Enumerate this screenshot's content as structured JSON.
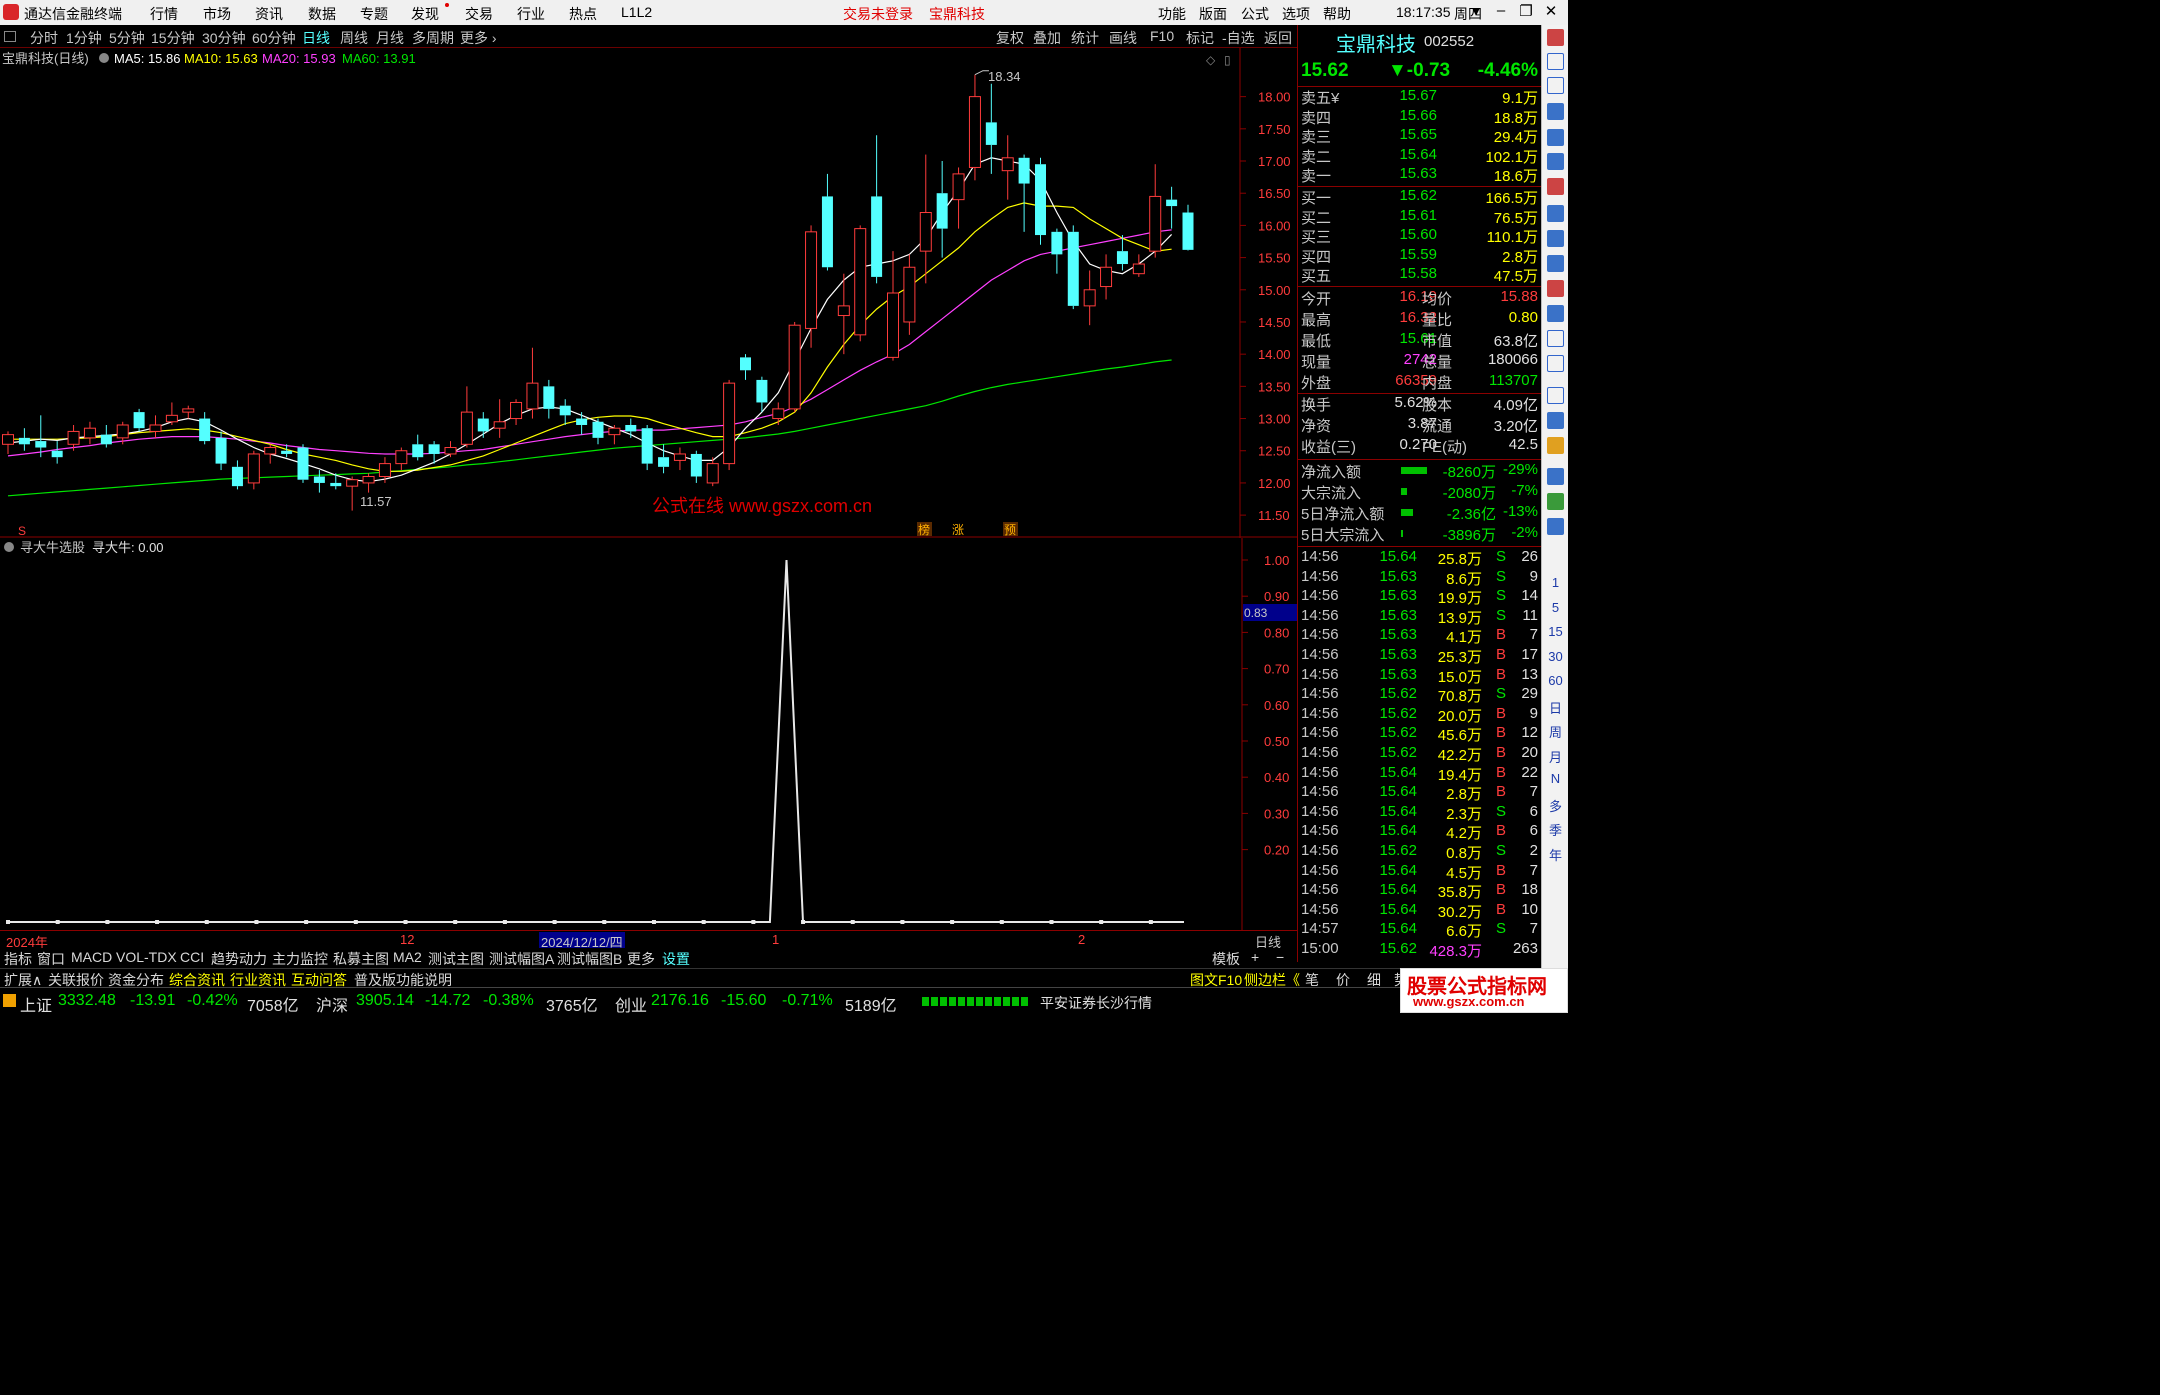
{
  "menubar": {
    "app_title": "通达信金融终端",
    "items": [
      "行情",
      "市场",
      "资讯",
      "数据",
      "专题",
      "发现",
      "交易",
      "行业",
      "热点",
      "L1L2"
    ],
    "login_status": "交易未登录",
    "stock_name": "宝鼎科技",
    "right_items": [
      "功能",
      "版面",
      "公式",
      "选项",
      "帮助"
    ],
    "time": "18:17:35",
    "weekday": "周四"
  },
  "periodbar": {
    "periods": [
      "分时",
      "1分钟",
      "5分钟",
      "15分钟",
      "30分钟",
      "60分钟",
      "日线",
      "周线",
      "月线",
      "多周期",
      "更多"
    ],
    "active": "日线",
    "tools": [
      "复权",
      "叠加",
      "统计",
      "画线",
      "F10",
      "标记",
      "-自选",
      "返回"
    ]
  },
  "chart_header": {
    "title": "宝鼎科技(日线)",
    "ma5": "MA5: 15.86",
    "ma10": "MA10: 15.63",
    "ma20": "MA20: 15.93",
    "ma60": "MA60: 13.91"
  },
  "chart_marks": {
    "high_label": "18.34",
    "low_label": "11.57",
    "watermark": "公式在线  www.gszx.com.cn",
    "flags": [
      "榜",
      "涨",
      "预"
    ],
    "s_flag": "S"
  },
  "indicator_header": {
    "name": "寻大牛选股",
    "value": "寻大牛: 0.00",
    "current_marker": "0.83"
  },
  "colors": {
    "up": "#ff3c3c",
    "down": "#54ffff",
    "ma5": "#ffffff",
    "ma10": "#ffff00",
    "ma20": "#ff40ff",
    "ma60": "#00e600",
    "grid": "#8b0000"
  },
  "chart_data": [
    {
      "type": "candlestick",
      "title": "宝鼎科技(日线)",
      "ylim": [
        11.3,
        18.6
      ],
      "yticks": [
        "18.00",
        "17.50",
        "17.00",
        "16.50",
        "16.00",
        "15.50",
        "15.00",
        "14.50",
        "14.00",
        "13.50",
        "13.00",
        "12.50",
        "12.00",
        "11.50"
      ],
      "candles": [
        [
          12.6,
          12.75,
          12.45,
          12.8
        ],
        [
          12.7,
          12.6,
          12.5,
          12.85
        ],
        [
          12.65,
          12.55,
          12.4,
          13.05
        ],
        [
          12.5,
          12.4,
          12.3,
          12.65
        ],
        [
          12.6,
          12.8,
          12.5,
          12.9
        ],
        [
          12.7,
          12.85,
          12.6,
          12.95
        ],
        [
          12.75,
          12.6,
          12.55,
          12.9
        ],
        [
          12.7,
          12.9,
          12.6,
          12.95
        ],
        [
          13.1,
          12.85,
          12.8,
          13.15
        ],
        [
          12.8,
          12.9,
          12.7,
          13.05
        ],
        [
          12.95,
          13.05,
          12.9,
          13.25
        ],
        [
          13.1,
          13.15,
          13.0,
          13.2
        ],
        [
          13.0,
          12.65,
          12.6,
          13.1
        ],
        [
          12.7,
          12.3,
          12.2,
          12.8
        ],
        [
          12.25,
          11.95,
          11.9,
          12.35
        ],
        [
          12.0,
          12.45,
          11.9,
          12.5
        ],
        [
          12.45,
          12.55,
          12.3,
          12.6
        ],
        [
          12.5,
          12.45,
          12.4,
          12.6
        ],
        [
          12.55,
          12.05,
          12.0,
          12.6
        ],
        [
          12.1,
          12.0,
          11.85,
          12.2
        ],
        [
          12.0,
          11.95,
          11.9,
          12.15
        ],
        [
          11.95,
          12.05,
          11.57,
          12.1
        ],
        [
          12.0,
          12.1,
          11.85,
          12.15
        ],
        [
          12.1,
          12.3,
          12.0,
          12.4
        ],
        [
          12.3,
          12.5,
          12.2,
          12.55
        ],
        [
          12.6,
          12.4,
          12.35,
          12.75
        ],
        [
          12.6,
          12.45,
          12.3,
          12.65
        ],
        [
          12.45,
          12.55,
          12.4,
          12.65
        ],
        [
          12.6,
          13.1,
          12.55,
          13.5
        ],
        [
          13.0,
          12.8,
          12.7,
          13.1
        ],
        [
          12.85,
          12.95,
          12.7,
          13.3
        ],
        [
          13.0,
          13.25,
          12.9,
          13.3
        ],
        [
          13.15,
          13.55,
          13.0,
          14.1
        ],
        [
          13.5,
          13.15,
          13.0,
          13.6
        ],
        [
          13.2,
          13.05,
          12.9,
          13.3
        ],
        [
          13.0,
          12.9,
          12.75,
          13.1
        ],
        [
          12.95,
          12.7,
          12.6,
          13.0
        ],
        [
          12.75,
          12.85,
          12.6,
          12.9
        ],
        [
          12.9,
          12.8,
          12.7,
          13.0
        ],
        [
          12.85,
          12.3,
          12.2,
          12.9
        ],
        [
          12.4,
          12.25,
          12.15,
          12.6
        ],
        [
          12.35,
          12.45,
          12.2,
          12.55
        ],
        [
          12.45,
          12.1,
          12.0,
          12.5
        ],
        [
          12.0,
          12.3,
          11.95,
          12.4
        ],
        [
          12.3,
          13.55,
          12.2,
          13.6
        ],
        [
          13.95,
          13.75,
          13.6,
          14.0
        ],
        [
          13.6,
          13.25,
          13.1,
          13.65
        ],
        [
          13.0,
          13.15,
          12.9,
          13.25
        ],
        [
          13.15,
          14.45,
          13.1,
          14.5
        ],
        [
          14.4,
          15.9,
          14.1,
          16.0
        ],
        [
          16.45,
          15.35,
          15.3,
          16.8
        ],
        [
          14.6,
          14.75,
          14.0,
          15.25
        ],
        [
          14.3,
          15.95,
          14.2,
          16.0
        ],
        [
          16.45,
          15.2,
          15.1,
          17.4
        ],
        [
          13.95,
          14.95,
          13.9,
          15.6
        ],
        [
          14.5,
          15.35,
          14.3,
          15.55
        ],
        [
          15.6,
          16.2,
          15.1,
          17.1
        ],
        [
          16.5,
          15.95,
          15.5,
          17.0
        ],
        [
          16.4,
          16.8,
          15.95,
          16.9
        ],
        [
          16.9,
          18.0,
          16.7,
          18.34
        ],
        [
          17.6,
          17.25,
          16.8,
          18.2
        ],
        [
          16.85,
          17.05,
          16.4,
          17.4
        ],
        [
          17.05,
          16.65,
          15.9,
          17.1
        ],
        [
          16.95,
          15.85,
          15.7,
          17.05
        ],
        [
          15.9,
          15.55,
          15.25,
          15.95
        ],
        [
          15.9,
          14.75,
          14.7,
          16.0
        ],
        [
          14.75,
          15.0,
          14.45,
          15.3
        ],
        [
          15.05,
          15.35,
          14.85,
          15.55
        ],
        [
          15.6,
          15.4,
          15.3,
          15.85
        ],
        [
          15.25,
          15.4,
          15.2,
          15.55
        ],
        [
          15.6,
          16.45,
          15.5,
          16.95
        ],
        [
          16.4,
          16.3,
          15.95,
          16.6
        ],
        [
          16.2,
          15.62,
          15.61,
          16.32
        ]
      ],
      "ma": {
        "MA5": [
          12.62,
          12.65,
          12.68,
          12.66,
          12.7,
          12.72,
          12.74,
          12.76,
          12.8,
          12.86,
          12.95,
          13.0,
          12.95,
          12.82,
          12.68,
          12.55,
          12.45,
          12.38,
          12.3,
          12.22,
          12.12,
          12.05,
          12.02,
          12.06,
          12.12,
          12.22,
          12.32,
          12.45,
          12.6,
          12.76,
          12.92,
          13.05,
          13.15,
          13.18,
          13.15,
          13.05,
          12.95,
          12.85,
          12.75,
          12.62,
          12.5,
          12.42,
          12.35,
          12.35,
          12.55,
          12.85,
          13.1,
          13.4,
          13.9,
          14.4,
          14.85,
          15.15,
          15.35,
          15.4,
          15.45,
          15.55,
          15.8,
          16.2,
          16.55,
          16.95,
          17.05,
          17.0,
          16.95,
          16.7,
          16.2,
          15.75,
          15.4,
          15.3,
          15.25,
          15.4,
          15.6,
          15.86
        ],
        "MA10": [
          12.68,
          12.68,
          12.68,
          12.68,
          12.69,
          12.7,
          12.72,
          12.75,
          12.78,
          12.8,
          12.82,
          12.84,
          12.82,
          12.78,
          12.72,
          12.66,
          12.6,
          12.52,
          12.45,
          12.4,
          12.35,
          12.28,
          12.22,
          12.18,
          12.18,
          12.2,
          12.24,
          12.28,
          12.35,
          12.42,
          12.52,
          12.62,
          12.72,
          12.82,
          12.92,
          12.98,
          13.02,
          13.04,
          13.04,
          13.0,
          12.92,
          12.85,
          12.78,
          12.72,
          12.72,
          12.78,
          12.85,
          12.95,
          13.1,
          13.4,
          13.8,
          14.15,
          14.45,
          14.7,
          14.9,
          15.05,
          15.25,
          15.45,
          15.65,
          15.9,
          16.1,
          16.28,
          16.35,
          16.3,
          16.3,
          16.28,
          16.1,
          15.95,
          15.8,
          15.7,
          15.6,
          15.63
        ],
        "MA20": [
          12.42,
          12.45,
          12.48,
          12.52,
          12.55,
          12.58,
          12.62,
          12.65,
          12.68,
          12.7,
          12.72,
          12.72,
          12.72,
          12.7,
          12.68,
          12.65,
          12.62,
          12.58,
          12.55,
          12.52,
          12.5,
          12.48,
          12.46,
          12.45,
          12.45,
          12.45,
          12.46,
          12.48,
          12.5,
          12.52,
          12.56,
          12.6,
          12.64,
          12.68,
          12.72,
          12.75,
          12.78,
          12.8,
          12.82,
          12.82,
          12.82,
          12.84,
          12.86,
          12.88,
          12.9,
          12.95,
          13.02,
          13.08,
          13.18,
          13.3,
          13.45,
          13.6,
          13.75,
          13.88,
          14.0,
          14.15,
          14.35,
          14.55,
          14.75,
          14.95,
          15.15,
          15.3,
          15.45,
          15.55,
          15.6,
          15.65,
          15.7,
          15.75,
          15.8,
          15.85,
          15.9,
          15.93
        ],
        "MA60": [
          11.8,
          11.82,
          11.84,
          11.86,
          11.88,
          11.9,
          11.92,
          11.94,
          11.96,
          11.98,
          12.0,
          12.02,
          12.04,
          12.06,
          12.07,
          12.08,
          12.09,
          12.1,
          12.11,
          12.12,
          12.13,
          12.14,
          12.15,
          12.17,
          12.19,
          12.21,
          12.23,
          12.25,
          12.28,
          12.3,
          12.33,
          12.36,
          12.39,
          12.42,
          12.45,
          12.48,
          12.51,
          12.54,
          12.56,
          12.58,
          12.6,
          12.62,
          12.64,
          12.66,
          12.68,
          12.7,
          12.73,
          12.76,
          12.8,
          12.85,
          12.9,
          12.95,
          13.0,
          13.05,
          13.1,
          13.15,
          13.2,
          13.27,
          13.35,
          13.42,
          13.48,
          13.53,
          13.57,
          13.61,
          13.65,
          13.69,
          13.73,
          13.77,
          13.8,
          13.84,
          13.88,
          13.91
        ]
      }
    },
    {
      "type": "line",
      "title": "寻大牛选股",
      "ylim": [
        0,
        1.0
      ],
      "yticks": [
        "1.00",
        "0.90",
        "0.80",
        "0.70",
        "0.60",
        "0.50",
        "0.40",
        "0.30",
        "0.20"
      ],
      "values": [
        0,
        0,
        0,
        0,
        0,
        0,
        0,
        0,
        0,
        0,
        0,
        0,
        0,
        0,
        0,
        0,
        0,
        0,
        0,
        0,
        0,
        0,
        0,
        0,
        0,
        0,
        0,
        0,
        0,
        0,
        0,
        0,
        0,
        0,
        0,
        0,
        0,
        0,
        0,
        0,
        0,
        0,
        0,
        0,
        0,
        0,
        0,
        1,
        0,
        0,
        0,
        0,
        0,
        0,
        0,
        0,
        0,
        0,
        0,
        0,
        0,
        0,
        0,
        0,
        0,
        0,
        0,
        0,
        0,
        0,
        0,
        0
      ]
    }
  ],
  "datebar": {
    "labels": [
      "2024年",
      "12",
      "2024/12/12/四",
      "1",
      "2"
    ],
    "period": "日线"
  },
  "tabbar1": {
    "items": [
      "指标",
      "窗口",
      "MACD",
      "VOL-TDX",
      "CCI",
      "趋势动力",
      "主力监控",
      "私募主图",
      "MA2",
      "测试主图",
      "测试幅图A",
      "测试幅图B",
      "更多",
      "设置"
    ],
    "right": [
      "模板",
      "+",
      "−"
    ]
  },
  "tabbar2": {
    "items": [
      "扩展∧",
      "关联报价",
      "资金分布",
      "综合资讯",
      "行业资讯",
      "互动问答",
      "普及版功能说明"
    ],
    "right": [
      "图文F10",
      "侧边栏《",
      "笔",
      "价",
      "细",
      "势"
    ]
  },
  "statusbar": {
    "indices": [
      {
        "name": "上证",
        "value": "3332.48",
        "change": "-13.91",
        "pct": "-0.42%",
        "amount": "7058亿"
      },
      {
        "name": "沪深",
        "value": "3905.14",
        "change": "-14.72",
        "pct": "-0.38%",
        "amount": "3765亿"
      },
      {
        "name": "创业",
        "value": "2176.16",
        "change": "-15.60",
        "pct": "-0.71%",
        "amount": "5189亿"
      }
    ],
    "broker": "平安证券长沙行情"
  },
  "quote": {
    "name": "宝鼎科技",
    "code": "002552",
    "price": "15.62",
    "change": "▼-0.73",
    "pct": "-4.46%",
    "asks": [
      {
        "label": "卖五¥",
        "price": "15.67",
        "vol": "9.1万"
      },
      {
        "label": "卖四",
        "price": "15.66",
        "vol": "18.8万"
      },
      {
        "label": "卖三",
        "price": "15.65",
        "vol": "29.4万"
      },
      {
        "label": "卖二",
        "price": "15.64",
        "vol": "102.1万"
      },
      {
        "label": "卖一",
        "price": "15.63",
        "vol": "18.6万"
      }
    ],
    "bids": [
      {
        "label": "买一",
        "price": "15.62",
        "vol": "166.5万"
      },
      {
        "label": "买二",
        "price": "15.61",
        "vol": "76.5万"
      },
      {
        "label": "买三",
        "price": "15.60",
        "vol": "110.1万"
      },
      {
        "label": "买四",
        "price": "15.59",
        "vol": "2.8万"
      },
      {
        "label": "买五",
        "price": "15.58",
        "vol": "47.5万"
      }
    ],
    "stats": [
      {
        "l1": "今开",
        "v1": "16.19",
        "l2": "均价",
        "v2": "15.88"
      },
      {
        "l1": "最高",
        "v1": "16.32",
        "l2": "量比",
        "v2": "0.80"
      },
      {
        "l1": "最低",
        "v1": "15.61",
        "l2": "市值",
        "v2": "63.8亿"
      },
      {
        "l1": "现量",
        "v1": "2742",
        "l2": "总量",
        "v2": "180066"
      },
      {
        "l1": "外盘",
        "v1": "66359",
        "l2": "内盘",
        "v2": "113707"
      }
    ],
    "stats2": [
      {
        "l1": "换手",
        "v1": "5.62%",
        "l2": "股本",
        "v2": "4.09亿"
      },
      {
        "l1": "净资",
        "v1": "3.87",
        "l2": "流通",
        "v2": "3.20亿"
      },
      {
        "l1": "收益(三)",
        "v1": "0.270",
        "l2": "PE(动)",
        "v2": "42.5"
      }
    ],
    "flows": [
      {
        "label": "净流入额",
        "value": "-8260万",
        "pct": "-29%",
        "bar": 0.29
      },
      {
        "label": "大宗流入",
        "value": "-2080万",
        "pct": "-7%",
        "bar": 0.07
      },
      {
        "label": "5日净流入额",
        "value": "-2.36亿",
        "pct": "-13%",
        "bar": 0.13
      },
      {
        "label": "5日大宗流入",
        "value": "-3896万",
        "pct": "-2%",
        "bar": 0.02
      }
    ],
    "ticks": [
      [
        "14:56",
        "15.64",
        "25.8万",
        "S",
        "26"
      ],
      [
        "14:56",
        "15.63",
        "8.6万",
        "S",
        "9"
      ],
      [
        "14:56",
        "15.63",
        "19.9万",
        "S",
        "14"
      ],
      [
        "14:56",
        "15.63",
        "13.9万",
        "S",
        "11"
      ],
      [
        "14:56",
        "15.63",
        "4.1万",
        "B",
        "7"
      ],
      [
        "14:56",
        "15.63",
        "25.3万",
        "B",
        "17"
      ],
      [
        "14:56",
        "15.63",
        "15.0万",
        "B",
        "13"
      ],
      [
        "14:56",
        "15.62",
        "70.8万",
        "S",
        "29"
      ],
      [
        "14:56",
        "15.62",
        "20.0万",
        "B",
        "9"
      ],
      [
        "14:56",
        "15.62",
        "45.6万",
        "B",
        "12"
      ],
      [
        "14:56",
        "15.62",
        "42.2万",
        "B",
        "20"
      ],
      [
        "14:56",
        "15.64",
        "19.4万",
        "B",
        "22"
      ],
      [
        "14:56",
        "15.64",
        "2.8万",
        "B",
        "7"
      ],
      [
        "14:56",
        "15.64",
        "2.3万",
        "S",
        "6"
      ],
      [
        "14:56",
        "15.64",
        "4.2万",
        "B",
        "6"
      ],
      [
        "14:56",
        "15.62",
        "0.8万",
        "S",
        "2"
      ],
      [
        "14:56",
        "15.64",
        "4.5万",
        "B",
        "7"
      ],
      [
        "14:56",
        "15.64",
        "35.8万",
        "B",
        "18"
      ],
      [
        "14:56",
        "15.64",
        "30.2万",
        "B",
        "10"
      ],
      [
        "14:57",
        "15.64",
        "6.6万",
        "S",
        "7"
      ],
      [
        "15:00",
        "15.62",
        "428.3万",
        "",
        "263"
      ]
    ]
  },
  "rstrip": {
    "period_labels": [
      "1",
      "5",
      "15",
      "30",
      "60",
      "日",
      "周",
      "月",
      "N",
      "多",
      "季",
      "年"
    ]
  },
  "site_watermark": {
    "line1": "股票公式指标网",
    "line2": "www.gszx.com.cn"
  }
}
